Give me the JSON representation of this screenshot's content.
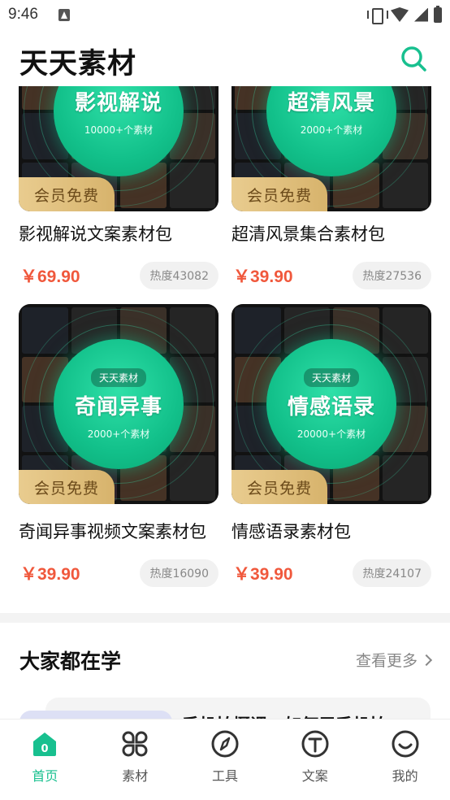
{
  "status_bar": {
    "time": "9:46"
  },
  "header": {
    "title": "天天素材"
  },
  "cards": [
    {
      "name": "影视解说文案素材包",
      "price": "￥69.90",
      "heat": "热度43082",
      "badge_tag": "",
      "badge_title": "影视解说",
      "badge_sub": "10000+个素材",
      "vip": "会员免费"
    },
    {
      "name": "超清风景集合素材包",
      "price": "￥39.90",
      "heat": "热度27536",
      "badge_tag": "",
      "badge_title": "超清风景",
      "badge_sub": "2000+个素材",
      "vip": "会员免费"
    },
    {
      "name": "奇闻异事视频文案素材包",
      "price": "￥39.90",
      "heat": "热度16090",
      "badge_tag": "天天素材",
      "badge_title": "奇闻异事",
      "badge_sub": "2000+个素材",
      "vip": "会员免费"
    },
    {
      "name": "情感语录素材包",
      "price": "￥39.90",
      "heat": "热度24107",
      "badge_tag": "天天素材",
      "badge_title": "情感语录",
      "badge_sub": "20000+个素材",
      "vip": "会员免费"
    }
  ],
  "section": {
    "title": "大家都在学",
    "see_more": "查看更多"
  },
  "course": {
    "title": "手机拍摄课：如何用手机拍"
  },
  "nav": [
    {
      "label": "首页",
      "icon": "home-icon"
    },
    {
      "label": "素材",
      "icon": "material-icon"
    },
    {
      "label": "工具",
      "icon": "compass-icon"
    },
    {
      "label": "文案",
      "icon": "text-icon"
    },
    {
      "label": "我的",
      "icon": "smile-icon"
    }
  ],
  "colors": {
    "accent": "#18c08f",
    "price": "#f0583c",
    "vip_gold": "#d7b36c"
  }
}
